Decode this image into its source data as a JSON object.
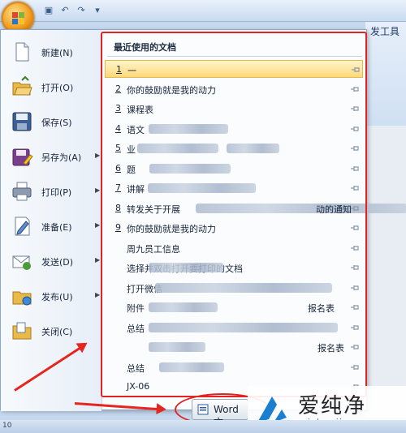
{
  "titlebar": {
    "right_tab": "发工具"
  },
  "office_menu": {
    "items": [
      {
        "label": "新建(N)",
        "icon": "new-document-icon",
        "arrow": false
      },
      {
        "label": "打开(O)",
        "icon": "open-folder-icon",
        "arrow": false
      },
      {
        "label": "保存(S)",
        "icon": "save-disk-icon",
        "arrow": false
      },
      {
        "label": "另存为(A)",
        "icon": "save-as-icon",
        "arrow": true
      },
      {
        "label": "打印(P)",
        "icon": "printer-icon",
        "arrow": true
      },
      {
        "label": "准备(E)",
        "icon": "prepare-icon",
        "arrow": true
      },
      {
        "label": "发送(D)",
        "icon": "send-mail-icon",
        "arrow": true
      },
      {
        "label": "发布(U)",
        "icon": "publish-icon",
        "arrow": true
      },
      {
        "label": "关闭(C)",
        "icon": "close-folder-icon",
        "arrow": false
      }
    ]
  },
  "recent": {
    "header": "最近使用的文档",
    "items": [
      {
        "num": "1",
        "name": "一"
      },
      {
        "num": "2",
        "name": "你的鼓励就是我的动力"
      },
      {
        "num": "3",
        "name": "课程表"
      },
      {
        "num": "4",
        "name": "语文"
      },
      {
        "num": "5",
        "name": "业"
      },
      {
        "num": "6",
        "name": "题"
      },
      {
        "num": "7",
        "name": "讲解"
      },
      {
        "num": "8",
        "name": "转发关于开展",
        "suffix": "动的通知"
      },
      {
        "num": "9",
        "name": "你的鼓励就是我的动力"
      },
      {
        "num": "",
        "name": "周九员工信息"
      },
      {
        "num": "",
        "name": "选择并双击打开要打印的文档"
      },
      {
        "num": "",
        "name": "打开微信"
      },
      {
        "num": "",
        "name": "附件",
        "suffix": "报名表"
      },
      {
        "num": "",
        "name": "总结"
      },
      {
        "num": "",
        "name": "",
        "suffix": "报名表"
      },
      {
        "num": "",
        "name": "总结"
      },
      {
        "num": "",
        "name": "JX-06"
      }
    ]
  },
  "taskbar": {
    "button_label": "Word 文"
  },
  "watermark": {
    "title": "爱纯净",
    "url": "aichunjing.com"
  },
  "statusbar": {
    "page_num": "10"
  },
  "colors": {
    "highlight": "#e02424",
    "selected": "#ffd97a",
    "menu_bg": "#f2f6fb"
  }
}
